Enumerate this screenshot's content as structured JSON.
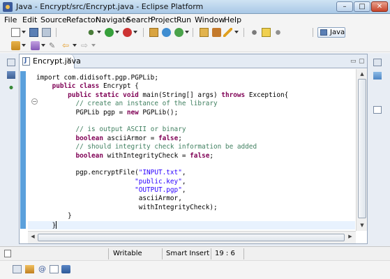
{
  "window": {
    "title": "Java - Encrypt/src/Encrypt.java - Eclipse Platform",
    "minimize": "–",
    "maximize": "□",
    "close": "✕"
  },
  "menu": [
    "File",
    "Edit",
    "Source",
    "Refactor",
    "Navigate",
    "Search",
    "Project",
    "Run",
    "Window",
    "Help"
  ],
  "perspective": {
    "label": "Java"
  },
  "editor": {
    "tab_label": "Encrypt.java",
    "tab_close": "✕",
    "minimize": "▭",
    "maximize": "▢"
  },
  "code_lines": [
    [
      {
        "t": "import com.didisoft.pgp.PGPLib;",
        "c": ""
      }
    ],
    [
      {
        "t": "    ",
        "c": ""
      },
      {
        "t": "public class",
        "c": "kw"
      },
      {
        "t": " Encrypt {",
        "c": ""
      }
    ],
    [
      {
        "t": "        ",
        "c": ""
      },
      {
        "t": "public static void",
        "c": "kw"
      },
      {
        "t": " main(String[] args) ",
        "c": ""
      },
      {
        "t": "throws",
        "c": "kw"
      },
      {
        "t": " Exception{",
        "c": ""
      }
    ],
    [
      {
        "t": "          ",
        "c": ""
      },
      {
        "t": "// create an instance of the library",
        "c": "cm"
      }
    ],
    [
      {
        "t": "          PGPLib pgp = ",
        "c": ""
      },
      {
        "t": "new",
        "c": "kw"
      },
      {
        "t": " PGPLib();",
        "c": ""
      }
    ],
    [
      {
        "t": "",
        "c": ""
      }
    ],
    [
      {
        "t": "          ",
        "c": ""
      },
      {
        "t": "// is output ASCII or binary",
        "c": "cm"
      }
    ],
    [
      {
        "t": "          ",
        "c": ""
      },
      {
        "t": "boolean",
        "c": "kw"
      },
      {
        "t": " asciiArmor = ",
        "c": ""
      },
      {
        "t": "false",
        "c": "kw"
      },
      {
        "t": ";",
        "c": ""
      }
    ],
    [
      {
        "t": "          ",
        "c": ""
      },
      {
        "t": "// should integrity check information be added",
        "c": "cm"
      }
    ],
    [
      {
        "t": "          ",
        "c": ""
      },
      {
        "t": "boolean",
        "c": "kw"
      },
      {
        "t": " withIntegrityCheck = ",
        "c": ""
      },
      {
        "t": "false",
        "c": "kw"
      },
      {
        "t": ";",
        "c": ""
      }
    ],
    [
      {
        "t": "",
        "c": ""
      }
    ],
    [
      {
        "t": "          pgp.encryptFile(",
        "c": ""
      },
      {
        "t": "\"INPUT.txt\"",
        "c": "st"
      },
      {
        "t": ",",
        "c": ""
      }
    ],
    [
      {
        "t": "                         ",
        "c": ""
      },
      {
        "t": "\"public.key\"",
        "c": "st"
      },
      {
        "t": ",",
        "c": ""
      }
    ],
    [
      {
        "t": "                         ",
        "c": ""
      },
      {
        "t": "\"OUTPUT.pgp\"",
        "c": "st"
      },
      {
        "t": ",",
        "c": ""
      }
    ],
    [
      {
        "t": "                          asciiArmor,",
        "c": ""
      }
    ],
    [
      {
        "t": "                          withIntegrityCheck);",
        "c": ""
      }
    ],
    [
      {
        "t": "        }",
        "c": ""
      }
    ],
    [
      {
        "t": "    }",
        "c": ""
      }
    ]
  ],
  "status": {
    "mode": "Writable",
    "insert": "Smart Insert",
    "position": "19 : 6"
  },
  "colors": {
    "keyword": "#7f0055",
    "comment": "#3f7f5f",
    "string": "#2a00ff",
    "current_line": "#e8f2fe",
    "ruler": "#5aa0dc"
  }
}
